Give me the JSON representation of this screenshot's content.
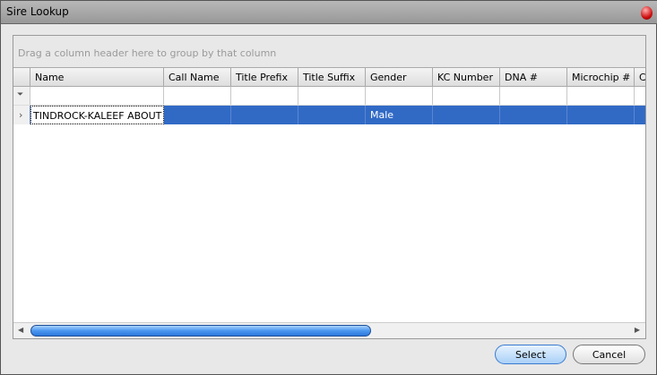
{
  "window": {
    "title": "Sire Lookup"
  },
  "grid": {
    "group_hint": "Drag a column header here to group by that column",
    "columns": [
      "Name",
      "Call Name",
      "Title Prefix",
      "Title Suffix",
      "Gender",
      "KC Number",
      "DNA #",
      "Microchip #",
      "C"
    ],
    "rows": [
      {
        "Name": "TINDROCK-KALEEF ABOUT ...",
        "Call Name": "",
        "Title Prefix": "",
        "Title Suffix": "",
        "Gender": "Male",
        "KC Number": "",
        "DNA #": "",
        "Microchip #": "",
        "C": ""
      }
    ],
    "selected_color": "#316ac5"
  },
  "buttons": {
    "select": "Select",
    "cancel": "Cancel"
  },
  "icons": {
    "filter": "funnel-icon",
    "row_indicator": "chevron-right-icon",
    "close": "close-icon"
  }
}
